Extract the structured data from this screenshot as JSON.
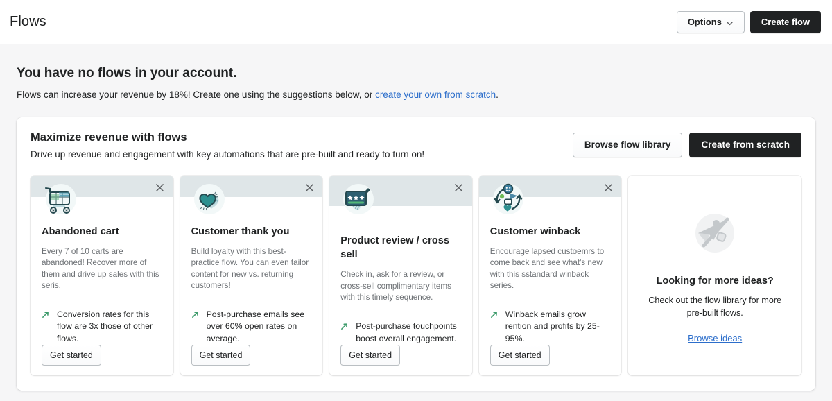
{
  "header": {
    "title": "Flows",
    "options_label": "Options",
    "create_flow_label": "Create flow"
  },
  "empty_state": {
    "heading": "You have no flows in your account.",
    "description_before": "Flows can increase your revenue by 18%! Create one using the suggestions below, or ",
    "link_text": "create your own from scratch",
    "description_after": "."
  },
  "panel": {
    "title": "Maximize revenue with flows",
    "subtitle": "Drive up revenue and engagement with key automations that are pre-built and ready to turn on!",
    "browse_library_label": "Browse flow library",
    "create_scratch_label": "Create from scratch"
  },
  "colors": {
    "page_background": "#f6f6f7",
    "card_banner": "#dfe6e8",
    "primary_button": "#202223",
    "link": "#2c6ecb",
    "trend_green": "#3f9c6d",
    "teal": "#2e8b8b",
    "muted_text": "#6d7175"
  },
  "cards": [
    {
      "icon": "shopping-cart-icon",
      "title": "Abandoned cart",
      "description": "Every 7 of 10 carts are abandoned! Recover more of them and drive up sales with this seris.",
      "stat": "Conversion rates for this flow are 3x those of other flows.",
      "button_label": "Get started"
    },
    {
      "icon": "heart-icon",
      "title": "Customer thank you",
      "description": "Build loyalty with this best-practice flow. You can even tailor content for new vs. returning customers!",
      "stat": "Post-purchase emails see over 60% open rates on average.",
      "button_label": "Get started"
    },
    {
      "icon": "review-stars-icon",
      "title": "Product review / cross sell",
      "description": "Check in, ask for a review, or cross-sell complimentary items with this timely sequence.",
      "stat": "Post-purchase touchpoints boost overall engagement.",
      "button_label": "Get started"
    },
    {
      "icon": "customer-winback-icon",
      "title": "Customer winback",
      "description": "Encourage lapsed custoemrs to come back and see what's new with this sstandard winback series.",
      "stat": "Winback emails grow rention and profits by 25-95%.",
      "button_label": "Get started"
    }
  ],
  "ideas_card": {
    "icon": "paper-plane-idea-icon",
    "title": "Looking for more ideas?",
    "description": "Check out the flow library for more pre-built flows.",
    "link_label": "Browse ideas"
  }
}
